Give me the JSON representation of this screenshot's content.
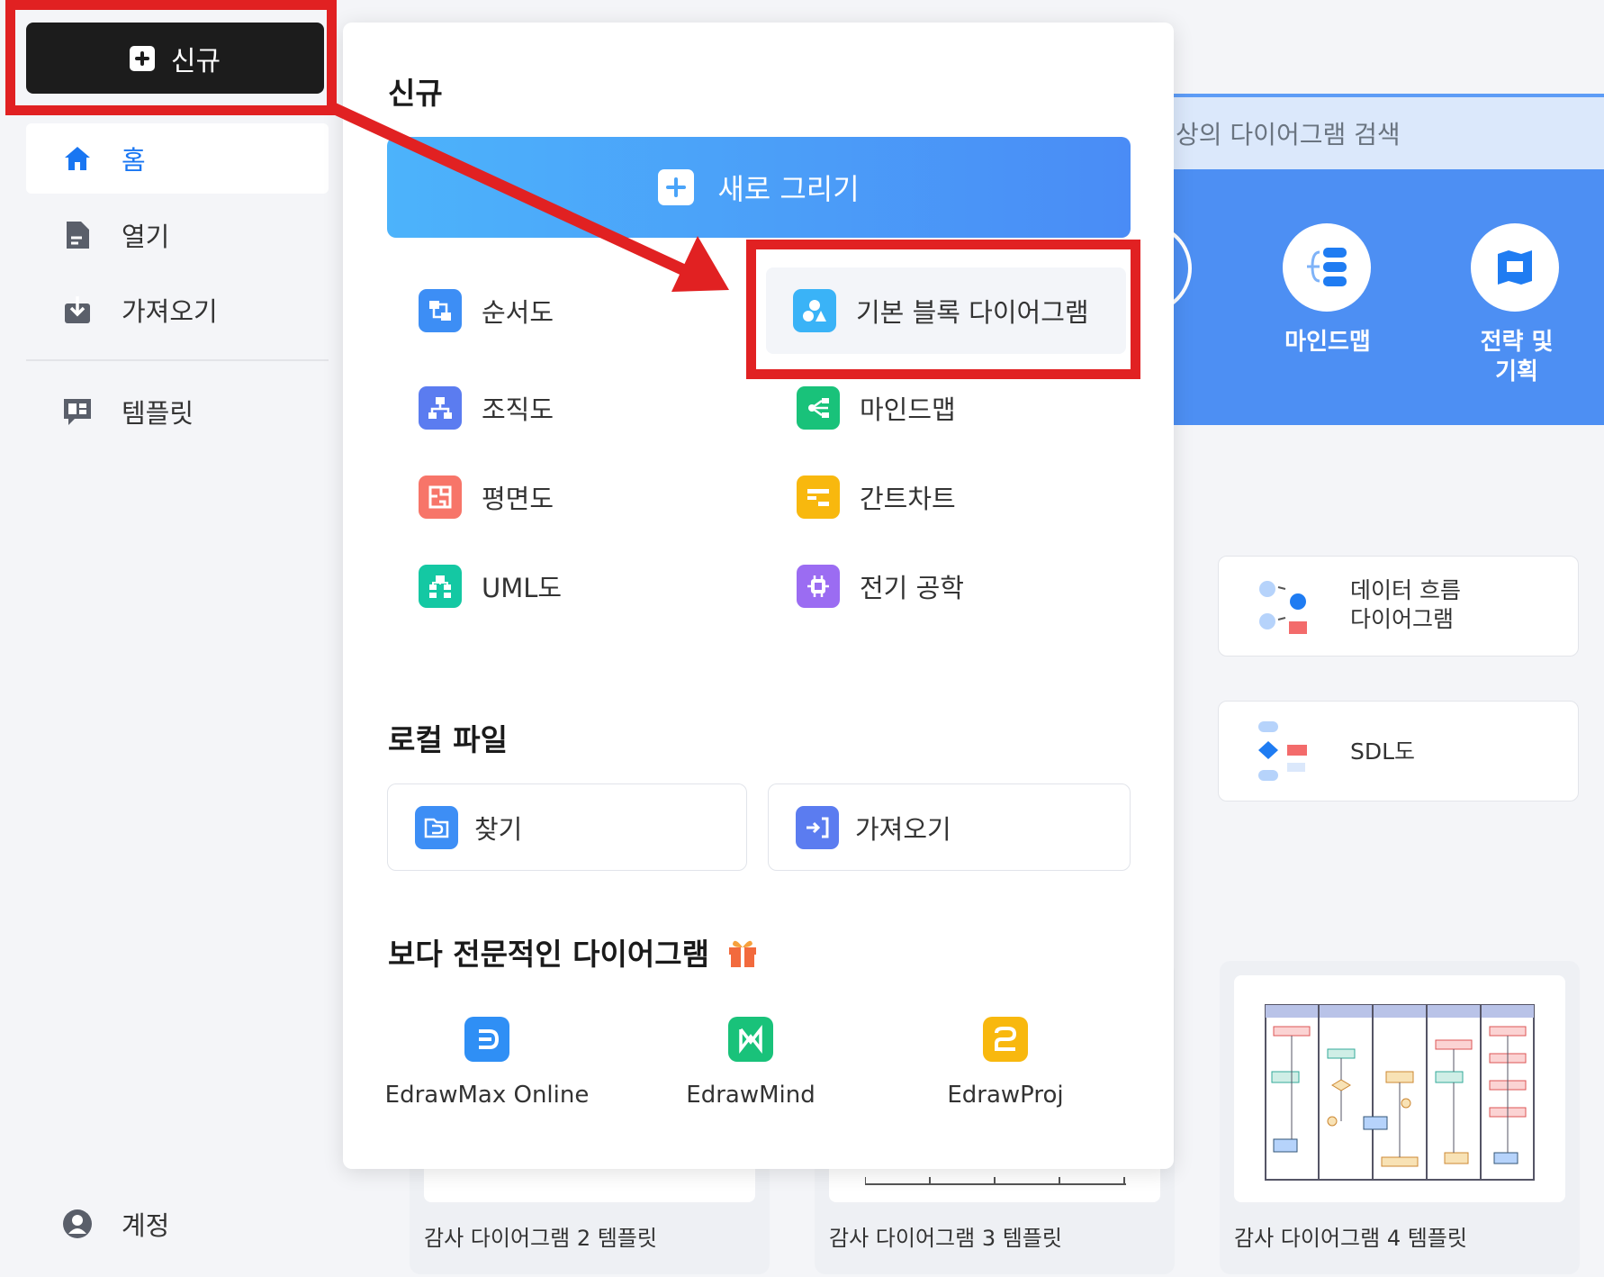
{
  "sidebar": {
    "new_button_label": "신규",
    "nav": {
      "home": "홈",
      "open": "열기",
      "import": "가져오기",
      "templates": "템플릿",
      "account": "계정"
    }
  },
  "popup": {
    "new_section_title": "신규",
    "draw_new_label": "새로 그리기",
    "diagrams": [
      {
        "label": "순서도",
        "color": "#3d8ef5",
        "icon": "flowchart-icon"
      },
      {
        "label": "기본 블록 다이어그램",
        "color": "#3ab3f7",
        "icon": "basic-shapes-icon"
      },
      {
        "label": "조직도",
        "color": "#5b7cf0",
        "icon": "org-chart-icon"
      },
      {
        "label": "마인드맵",
        "color": "#19c27a",
        "icon": "mind-map-icon"
      },
      {
        "label": "평면도",
        "color": "#f77569",
        "icon": "floor-plan-icon"
      },
      {
        "label": "간트차트",
        "color": "#f8b80e",
        "icon": "gantt-chart-icon"
      },
      {
        "label": "UML도",
        "color": "#14c8a3",
        "icon": "uml-icon"
      },
      {
        "label": "전기 공학",
        "color": "#9b6cf2",
        "icon": "electrical-icon"
      }
    ],
    "local_section_title": "로컬 파일",
    "local": {
      "find_label": "찾기",
      "import_label": "가져오기"
    },
    "pro_section_title": "보다 전문적인 다이어그램",
    "products": [
      {
        "label": "EdrawMax Online",
        "color": "#2f8ff5"
      },
      {
        "label": "EdrawMind",
        "color": "#19c27a"
      },
      {
        "label": "EdrawProj",
        "color": "#f8b80e"
      }
    ]
  },
  "background": {
    "search_placeholder": "상의 다이어그램 검색",
    "banner": {
      "mindmap_label": "마인드맵",
      "strategy_label": "전략 및\n기획"
    },
    "cards": {
      "dfd_title": "데이터 흐름\n다이어그램",
      "sdl_title": "SDL도"
    },
    "templates": [
      "감사 다이어그램 2 템플릿",
      "감사 다이어그램 3 템플릿",
      "감사 다이어그램 4 템플릿"
    ]
  },
  "colors": {
    "accent": "#1976f2",
    "annotation_red": "#e12122",
    "new_button_bg": "#1c1c1c"
  }
}
